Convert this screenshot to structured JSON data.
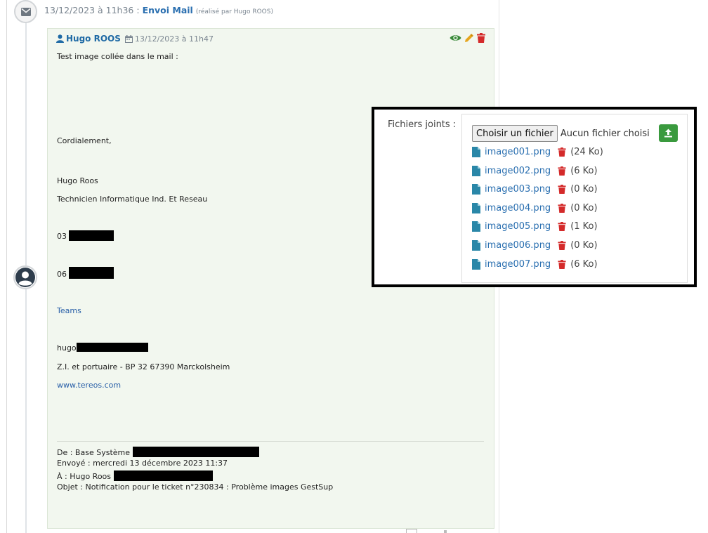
{
  "event": {
    "date": "13/12/2023 à 11h36",
    "separator": ":",
    "title": "Envoi Mail",
    "by": "(réalisé par Hugo ROOS)"
  },
  "message": {
    "author": "Hugo ROOS",
    "date": "13/12/2023 à 11h47",
    "lines": {
      "intro": "Test image collée dans le mail :",
      "regards": "Cordialement,",
      "name": "Hugo Roos",
      "role": "Technicien Informatique Ind. Et Reseau",
      "phone1_prefix": "03",
      "phone2_prefix": "06",
      "teams": "Teams",
      "email_prefix": "hugo",
      "address": "Z.I. et portuaire - BP 32 67390 Marckolsheim",
      "website": "www.tereos.com"
    },
    "quoted": {
      "from": "De : Base Système",
      "sent": "Envoyé : mercredi 13 décembre 2023 11:37",
      "to": "À : Hugo Roos",
      "subject": "Objet : Notification pour le ticket n°230834 : Problème images GestSup"
    }
  },
  "attachments": {
    "label": "Fichiers joints :",
    "choose_button": "Choisir un fichier",
    "no_file": "Aucun fichier choisi",
    "files": [
      {
        "name": "image001.png",
        "size": "(24 Ko)"
      },
      {
        "name": "image002.png",
        "size": "(6 Ko)"
      },
      {
        "name": "image003.png",
        "size": "(0 Ko)"
      },
      {
        "name": "image004.png",
        "size": "(0 Ko)"
      },
      {
        "name": "image005.png",
        "size": "(1 Ko)"
      },
      {
        "name": "image006.png",
        "size": "(0 Ko)"
      },
      {
        "name": "image007.png",
        "size": "(6 Ko)"
      }
    ]
  },
  "icons": {
    "event": "envelope-icon",
    "user": "user-icon",
    "date": "calendar-icon",
    "view": "eye-icon",
    "edit": "pencil-icon",
    "delete": "trash-icon",
    "upload": "upload-icon",
    "file": "file-icon",
    "avatar": "avatar-icon"
  },
  "colors": {
    "link": "#2a6fb0",
    "author": "#1f6aa5",
    "view": "#3a8a3a",
    "edit": "#e6a51e",
    "delete": "#d42a2a",
    "upload": "#3a9a3e",
    "file": "#2a87a8",
    "card_bg": "#f2f7ef"
  }
}
